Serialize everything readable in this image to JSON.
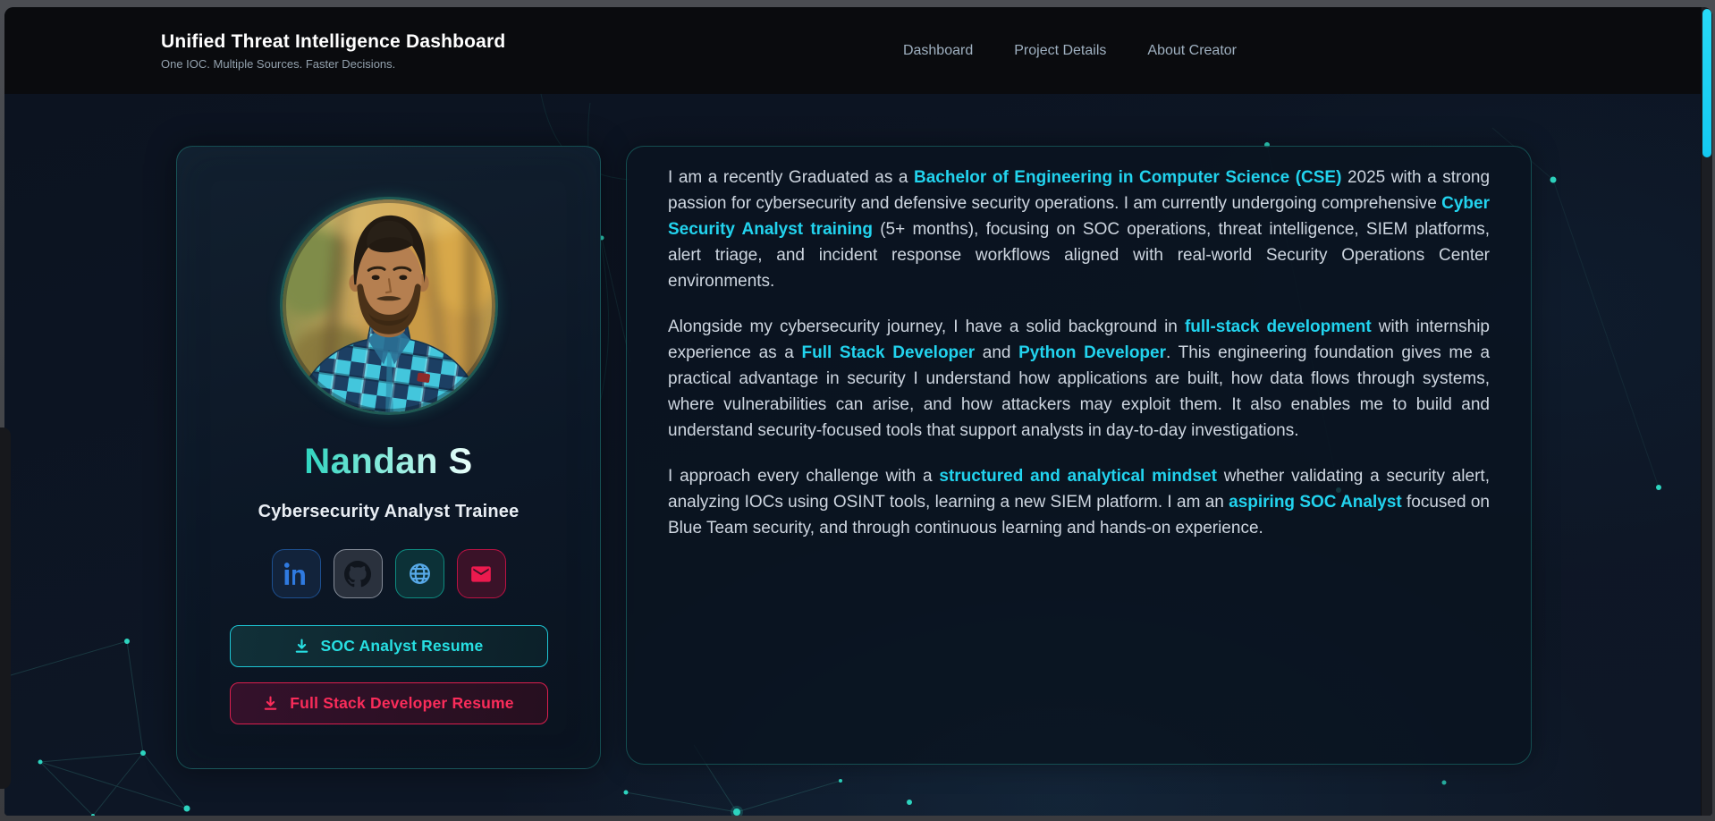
{
  "header": {
    "title": "Unified Threat Intelligence Dashboard",
    "subtitle": "One IOC. Multiple Sources. Faster Decisions.",
    "nav": [
      {
        "label": "Dashboard"
      },
      {
        "label": "Project Details"
      },
      {
        "label": "About Creator"
      }
    ]
  },
  "profile": {
    "name": "Nandan S",
    "role": "Cybersecurity Analyst Trainee",
    "socials": [
      {
        "icon": "linkedin-icon"
      },
      {
        "icon": "github-icon"
      },
      {
        "icon": "globe-icon"
      },
      {
        "icon": "mail-icon"
      }
    ],
    "buttons": [
      {
        "label": "SOC Analyst Resume",
        "icon": "download-icon",
        "color": "#22d3ee"
      },
      {
        "label": "Full Stack Developer Resume",
        "icon": "download-icon",
        "color": "#f43f5e"
      }
    ]
  },
  "about": {
    "paragraphs": [
      {
        "segments": [
          {
            "text": "I am a recently Graduated as a ",
            "highlight": false
          },
          {
            "text": "Bachelor of Engineering in Computer Science (CSE)",
            "highlight": true
          },
          {
            "text": " 2025 with a strong passion for cybersecurity and defensive security operations. I am currently undergoing comprehensive ",
            "highlight": false
          },
          {
            "text": "Cyber Security Analyst training",
            "highlight": true
          },
          {
            "text": " (5+ months), focusing on SOC operations, threat intelligence, SIEM platforms, alert triage, and incident response workflows aligned with real-world Security Operations Center environments.",
            "highlight": false
          }
        ]
      },
      {
        "segments": [
          {
            "text": "Alongside my cybersecurity journey, I have a solid background in ",
            "highlight": false
          },
          {
            "text": "full-stack development",
            "highlight": true
          },
          {
            "text": " with internship experience as a ",
            "highlight": false
          },
          {
            "text": "Full Stack Developer",
            "highlight": true
          },
          {
            "text": " and ",
            "highlight": false
          },
          {
            "text": "Python Developer",
            "highlight": true
          },
          {
            "text": ". This engineering foundation gives me a practical advantage in security I understand how applications are built, how data flows through systems, where vulnerabilities can arise, and how attackers may exploit them. It also enables me to build and understand security-focused tools that support analysts in day-to-day investigations.",
            "highlight": false
          }
        ]
      },
      {
        "segments": [
          {
            "text": "I approach every challenge with a ",
            "highlight": false
          },
          {
            "text": "structured and analytical mindset",
            "highlight": true
          },
          {
            "text": " whether validating a security alert, analyzing IOCs using OSINT tools, learning a new SIEM platform. I am an ",
            "highlight": false
          },
          {
            "text": "aspiring SOC Analyst",
            "highlight": true
          },
          {
            "text": " focused on Blue Team security, and through continuous learning and hands-on experience.",
            "highlight": false
          }
        ]
      }
    ]
  },
  "colors": {
    "accent_cyan": "#22d3ee",
    "accent_teal": "#2dd4bf",
    "accent_pink": "#f43f5e",
    "linkedin_blue": "#2f7ae0",
    "scrollbar_thumb": "#1ccdf2"
  }
}
